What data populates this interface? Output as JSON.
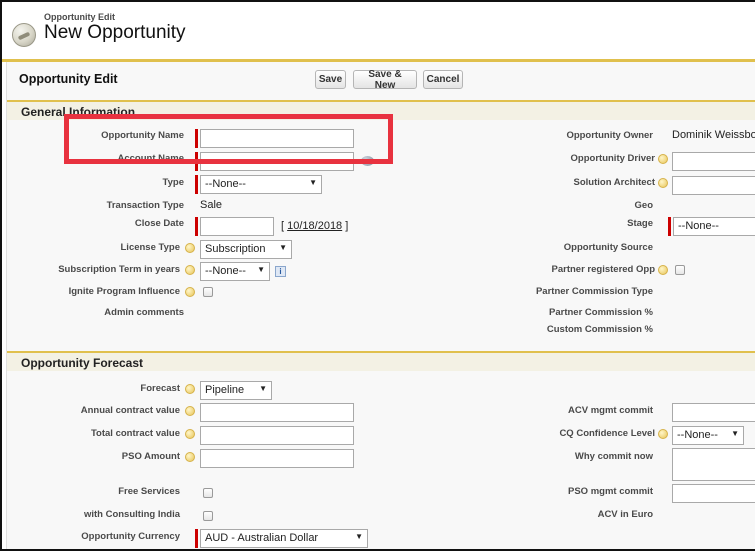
{
  "header": {
    "subtitle": "Opportunity Edit",
    "title": "New Opportunity"
  },
  "toolbar": {
    "section_title": "Opportunity Edit",
    "save_label": "Save",
    "save_new_label": "Save & New",
    "cancel_label": "Cancel"
  },
  "general": {
    "title": "General Information",
    "left": {
      "opportunity_name": {
        "label": "Opportunity Name",
        "value": ""
      },
      "account_name": {
        "label": "Account Name",
        "value": ""
      },
      "type": {
        "label": "Type",
        "value": "--None--"
      },
      "transaction_type": {
        "label": "Transaction Type",
        "value": "Sale"
      },
      "close_date": {
        "label": "Close Date",
        "value": "",
        "today": "10/18/2018",
        "bracket_open": "[",
        "bracket_close": "]"
      },
      "license_type": {
        "label": "License Type",
        "value": "Subscription"
      },
      "subscription_term": {
        "label": "Subscription Term in years",
        "value": "--None--",
        "info": "i"
      },
      "ignite": {
        "label": "Ignite Program Influence",
        "checked": false
      },
      "admin_comments": {
        "label": "Admin comments",
        "value": ""
      }
    },
    "right": {
      "owner": {
        "label": "Opportunity Owner",
        "value": "Dominik Weissbo"
      },
      "driver": {
        "label": "Opportunity Driver",
        "value": ""
      },
      "solution_architect": {
        "label": "Solution Architect",
        "value": ""
      },
      "geo": {
        "label": "Geo",
        "value": ""
      },
      "stage": {
        "label": "Stage",
        "value": "--None--"
      },
      "source": {
        "label": "Opportunity Source",
        "value": ""
      },
      "partner_registered": {
        "label": "Partner registered Opp",
        "checked": false
      },
      "partner_commission_type": {
        "label": "Partner Commission Type",
        "value": ""
      },
      "partner_commission_pct": {
        "label": "Partner Commission %",
        "value": ""
      },
      "custom_commission_pct": {
        "label": "Custom Commission %",
        "value": ""
      }
    }
  },
  "forecast": {
    "title": "Opportunity Forecast",
    "left": {
      "forecast": {
        "label": "Forecast",
        "value": "Pipeline"
      },
      "annual_contract_value": {
        "label": "Annual contract value",
        "value": ""
      },
      "total_contract_value": {
        "label": "Total contract value",
        "value": ""
      },
      "pso_amount": {
        "label": "PSO Amount",
        "value": ""
      },
      "free_services": {
        "label": "Free Services",
        "checked": false
      },
      "consulting_india": {
        "label": "with Consulting India",
        "checked": false
      },
      "currency": {
        "label": "Opportunity Currency",
        "value": "AUD - Australian Dollar"
      }
    },
    "right": {
      "acv_mgmt_commit": {
        "label": "ACV mgmt commit",
        "value": ""
      },
      "cq_confidence": {
        "label": "CQ Confidence Level",
        "value": "--None--"
      },
      "why_commit_now": {
        "label": "Why commit now",
        "value": ""
      },
      "pso_mgmt_commit": {
        "label": "PSO mgmt commit",
        "value": ""
      },
      "acv_in_euro": {
        "label": "ACV in Euro",
        "value": ""
      }
    }
  },
  "colors": {
    "accent_gold": "#e0c04d",
    "required_red": "#c00000",
    "highlight_red": "#e8323f"
  },
  "icons": {
    "app": "opportunity-coin-icon",
    "help": "help-bubble-icon",
    "lookup": "lookup-icon",
    "dropdown": "chevron-down-icon"
  }
}
